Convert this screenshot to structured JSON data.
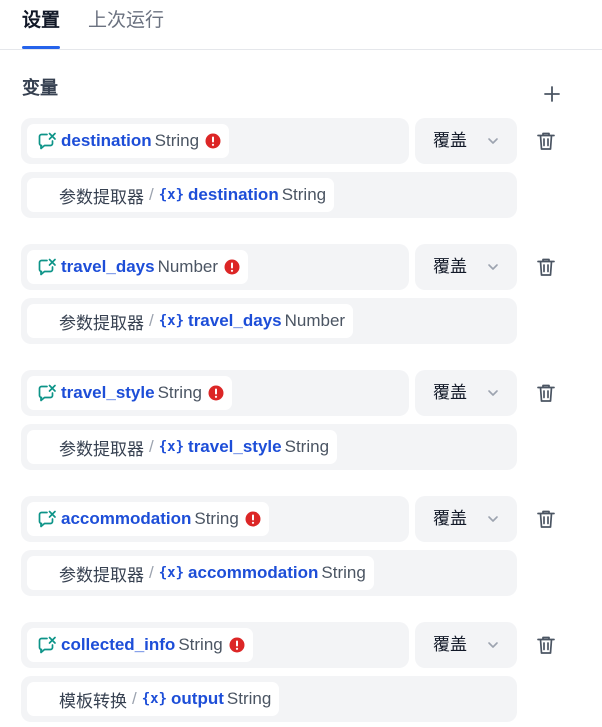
{
  "tabs": [
    {
      "label": "设置"
    },
    {
      "label": "上次运行"
    }
  ],
  "section": {
    "title": "变量"
  },
  "assigner": {
    "operation_label": "覆盖",
    "items": [
      {
        "var_name": "destination",
        "var_type": "String",
        "source_node": "参数提取器",
        "source_var": "destination",
        "source_type": "String"
      },
      {
        "var_name": "travel_days",
        "var_type": "Number",
        "source_node": "参数提取器",
        "source_var": "travel_days",
        "source_type": "Number"
      },
      {
        "var_name": "travel_style",
        "var_type": "String",
        "source_node": "参数提取器",
        "source_var": "travel_style",
        "source_type": "String"
      },
      {
        "var_name": "accommodation",
        "var_type": "String",
        "source_node": "参数提取器",
        "source_var": "accommodation",
        "source_type": "String"
      },
      {
        "var_name": "collected_info",
        "var_type": "String",
        "source_node": "模板转换",
        "source_var": "output",
        "source_type": "String"
      }
    ]
  },
  "icons": {
    "variable": "conversation-variable-icon",
    "error": "error-icon",
    "dropdown": "chevron-down-icon",
    "delete": "trash-icon",
    "add": "plus-icon"
  },
  "colors": {
    "accent": "#2563eb",
    "variable_text": "#1d4ed8",
    "error": "#dc2626",
    "box_bg": "#f3f4f6"
  }
}
